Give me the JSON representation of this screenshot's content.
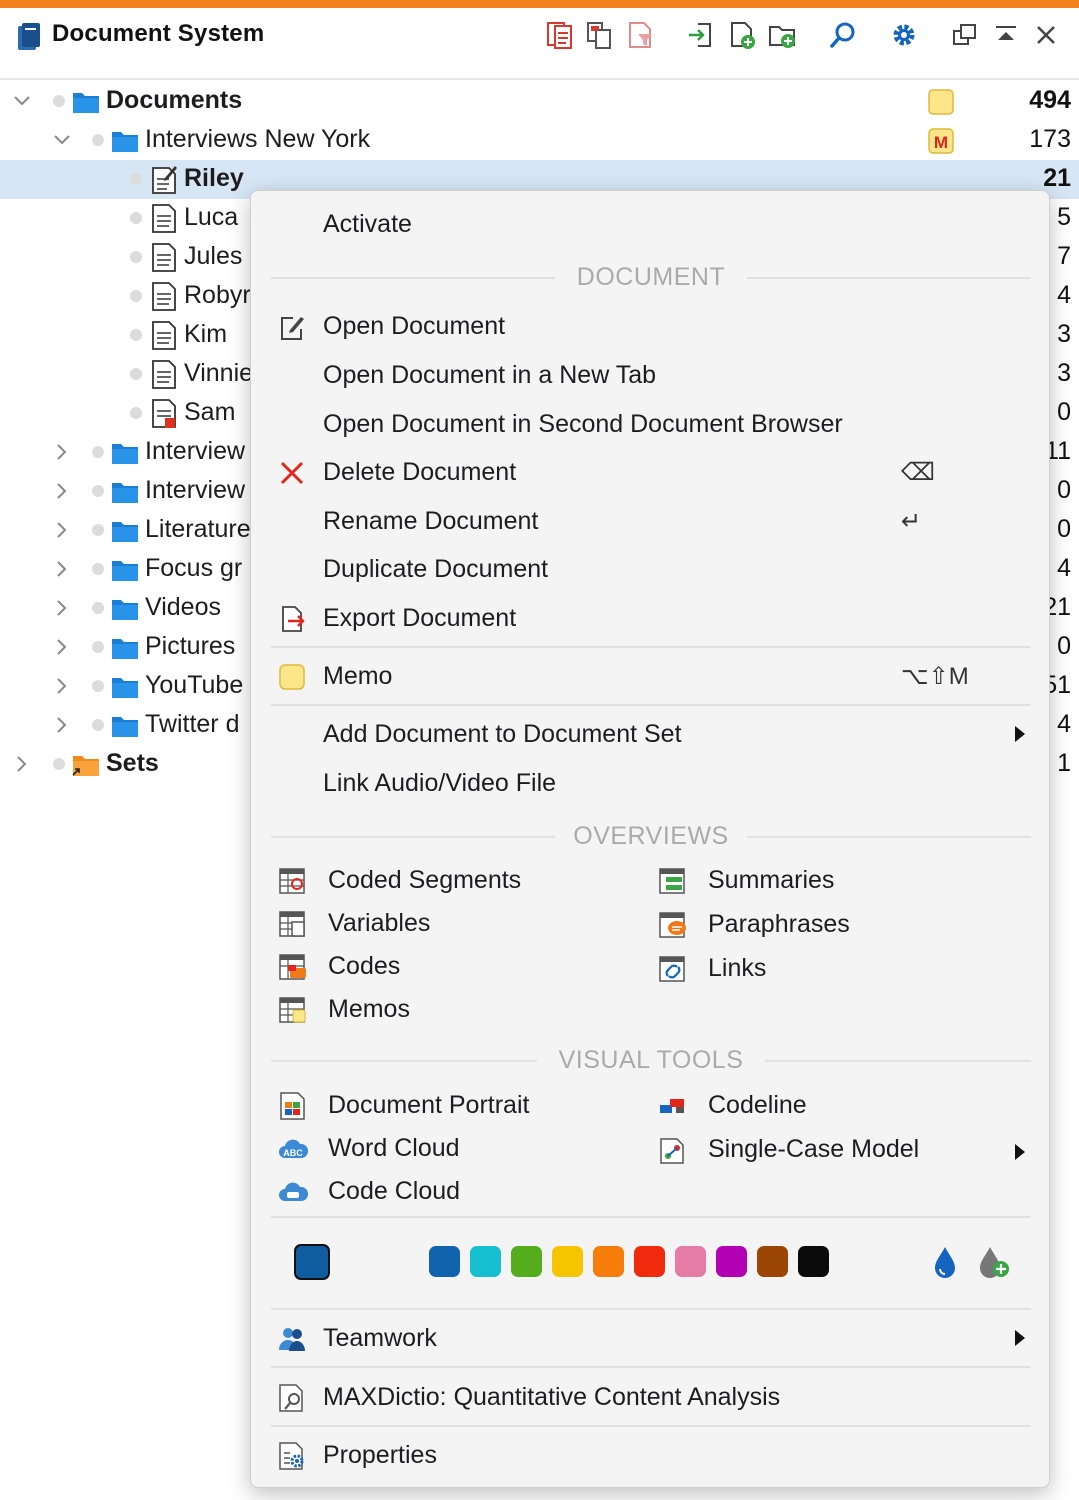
{
  "window": {
    "title": "Document System"
  },
  "toolbar": {
    "icons": [
      "activate-all-icon",
      "copy-icon",
      "filter-icon",
      "import-icon",
      "new-document-icon",
      "new-folder-icon",
      "search-icon",
      "gear-icon",
      "undock-icon",
      "collapse-icon",
      "close-icon"
    ],
    "accent": "#f58220"
  },
  "tree": {
    "root": {
      "label": "Documents",
      "count": "494"
    },
    "group": {
      "label": "Interviews New York",
      "count": "173"
    },
    "documents": [
      {
        "label": "Riley",
        "count": "21"
      },
      {
        "label": "Luca",
        "count": "5"
      },
      {
        "label": "Jules",
        "count": "7"
      },
      {
        "label": "Robyr",
        "count": "4"
      },
      {
        "label": "Kim",
        "count": "3"
      },
      {
        "label": "Vinnie",
        "count": "3"
      },
      {
        "label": "Sam",
        "count": "0"
      }
    ],
    "groups": [
      {
        "label": "Interview",
        "count": "11"
      },
      {
        "label": "Interview",
        "count": "0"
      },
      {
        "label": "Literature",
        "count": "0"
      },
      {
        "label": "Focus gr",
        "count": "4"
      },
      {
        "label": "Videos",
        "count": "21"
      },
      {
        "label": "Pictures",
        "count": "0"
      },
      {
        "label": "YouTube",
        "count": "51"
      },
      {
        "label": "Twitter d",
        "count": "4"
      }
    ],
    "sets": {
      "label": "Sets",
      "count": "1"
    }
  },
  "menu": {
    "activate": "Activate",
    "section_document": "DOCUMENT",
    "open": "Open Document",
    "open_tab": "Open Document in a New Tab",
    "open_second": "Open Document in Second Document Browser",
    "delete": "Delete Document",
    "delete_shortcut": "⌫",
    "rename": "Rename Document",
    "rename_shortcut": "↵",
    "duplicate": "Duplicate Document",
    "export": "Export Document",
    "memo": "Memo",
    "memo_shortcut": "⌥⇧M",
    "add_set": "Add Document to Document Set",
    "link_av": "Link Audio/Video File",
    "section_overviews": "OVERVIEWS",
    "overviews_left": [
      "Coded Segments",
      "Variables",
      "Codes",
      "Memos"
    ],
    "overviews_right": [
      "Summaries",
      "Paraphrases",
      "Links"
    ],
    "section_visual": "VISUAL TOOLS",
    "visual_left": [
      "Document Portrait",
      "Word Cloud",
      "Code Cloud"
    ],
    "visual_right": [
      "Codeline",
      "Single-Case Model"
    ],
    "colors": {
      "current": "#0f5c9f",
      "palette": [
        "#0f64ad",
        "#16c0d1",
        "#55ad1e",
        "#f6c502",
        "#f67d09",
        "#f02a0c",
        "#e57ca6",
        "#b300b4",
        "#9b4604",
        "#0b0b0b"
      ]
    },
    "teamwork": "Teamwork",
    "maxdictio": "MAXDictio: Quantitative Content Analysis",
    "properties": "Properties"
  }
}
